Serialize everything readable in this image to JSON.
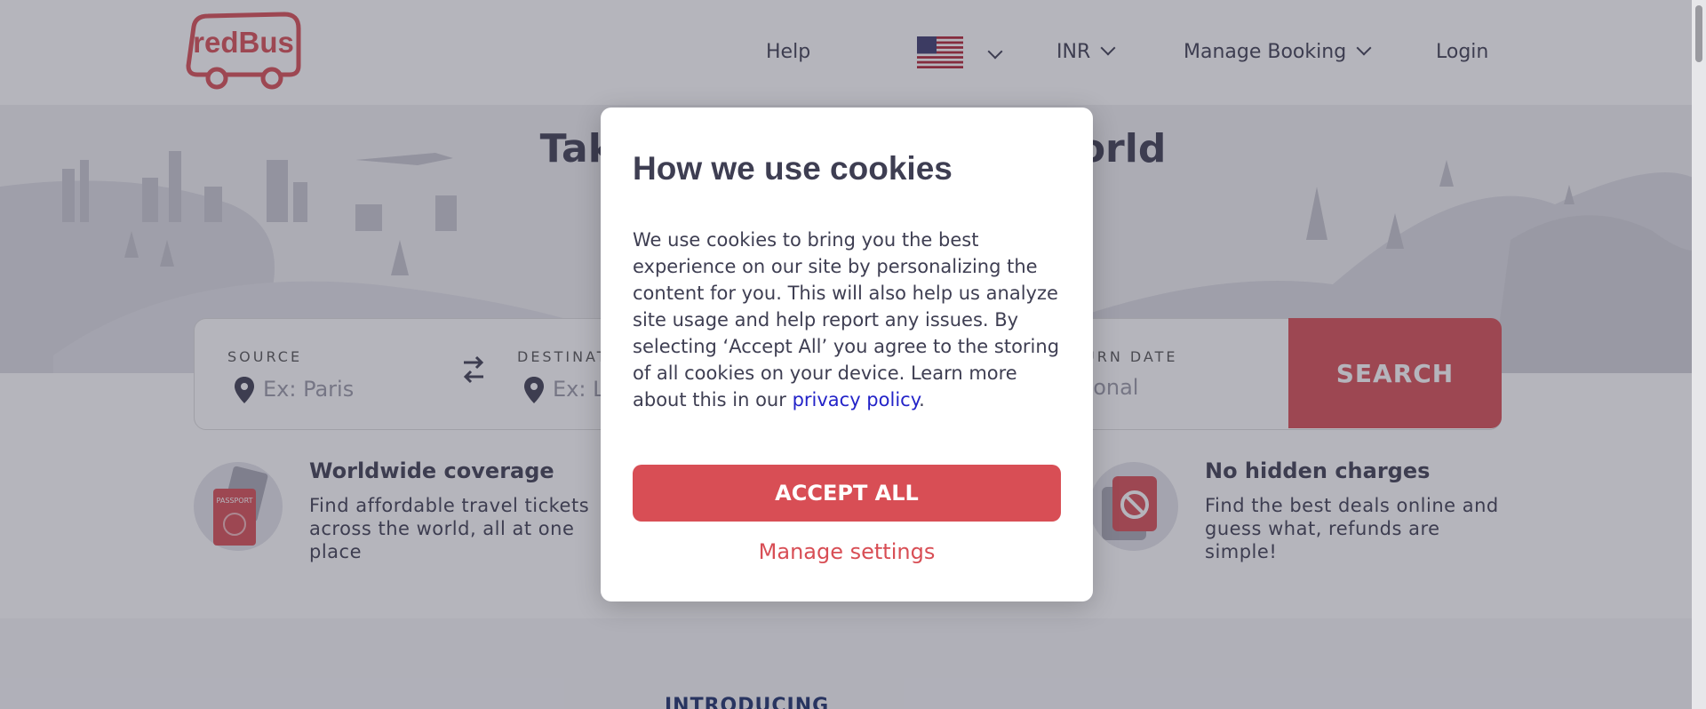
{
  "header": {
    "logo_text": "redBus",
    "nav": {
      "help": "Help",
      "currency": "INR",
      "manage_booking": "Manage Booking",
      "login": "Login"
    }
  },
  "hero": {
    "title": "Take a trip around the world"
  },
  "search": {
    "source_label": "SOURCE",
    "source_placeholder": "Ex: Paris",
    "destination_label": "DESTINATION",
    "destination_placeholder": "Ex: London",
    "return_label": "RETURN DATE",
    "return_placeholder": "Optional",
    "search_button": "SEARCH"
  },
  "features": [
    {
      "title": "Worldwide coverage",
      "text": "Find affordable travel tickets across the world, all at one place"
    },
    {
      "title": "No hidden charges",
      "text": "Find the best deals online and guess what, refunds are simple!"
    }
  ],
  "intro": {
    "text": "INTRODUCING"
  },
  "cookie_modal": {
    "title": "How we use cookies",
    "body": "We use cookies to bring you the best experience on our site by personalizing the content for you. This will also help us analyze site usage and help report any issues. By selecting ‘Accept All’ you agree to the storing of all cookies on your device. Learn more about this in our",
    "link_text": "privacy policy",
    "body_end": ".",
    "accept_button": "ACCEPT ALL",
    "manage_link": "Manage settings"
  },
  "colors": {
    "brand_red": "#d84e55",
    "text_dark": "#3e3e52",
    "link_blue": "#2323c8"
  },
  "icons": [
    "pin-icon",
    "swap-icon",
    "chevron-down-icon",
    "us-flag-icon",
    "passport-icon",
    "no-charge-icon"
  ]
}
